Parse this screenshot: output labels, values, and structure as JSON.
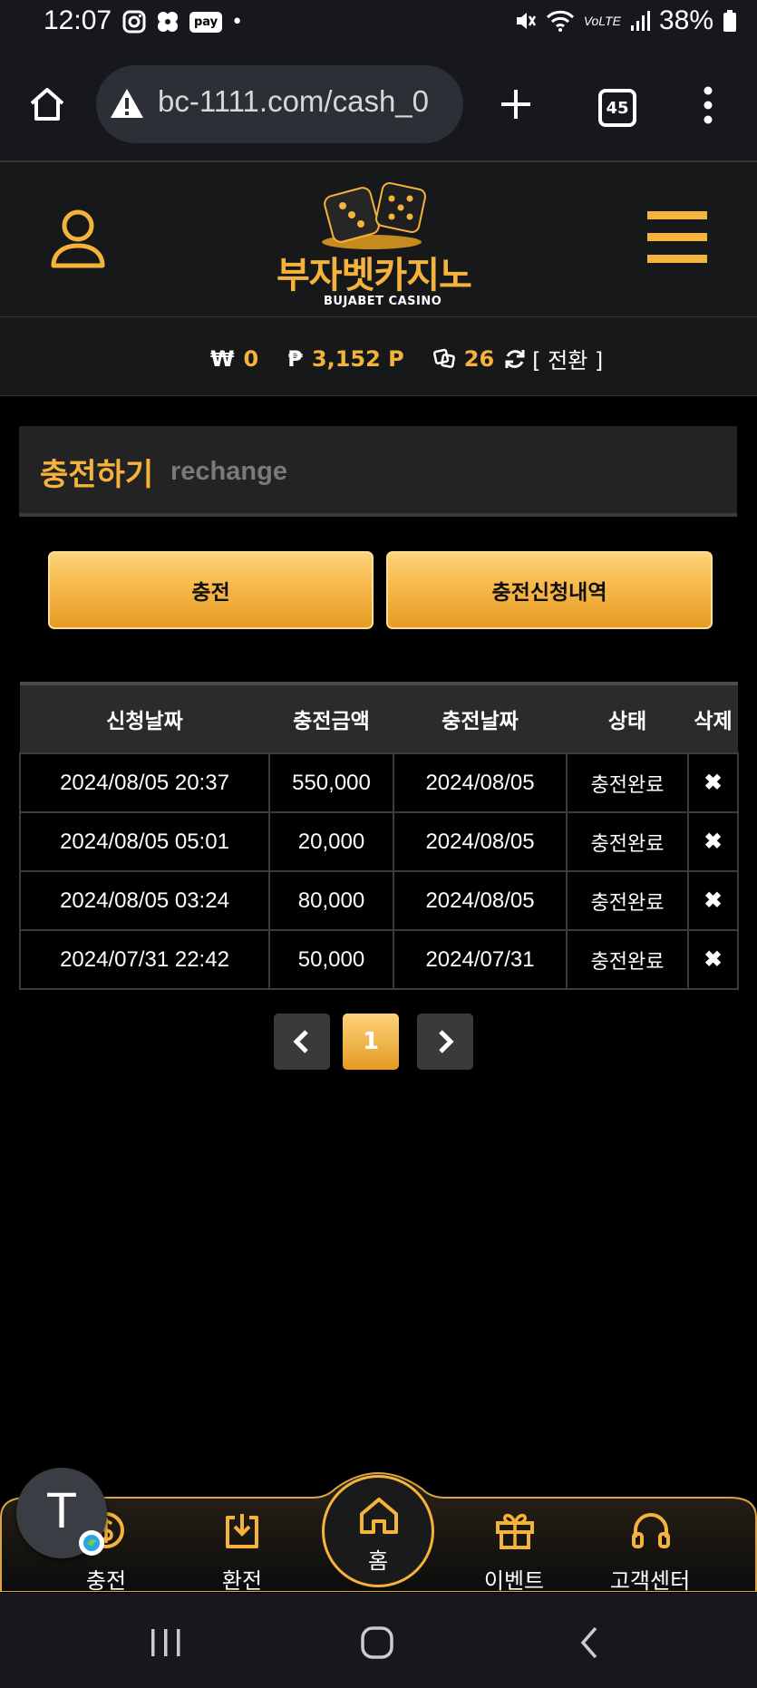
{
  "status_bar": {
    "time": "12:07",
    "pay_badge": "pay",
    "dot": "•",
    "network": "VoLTE",
    "battery": "38%"
  },
  "browser": {
    "url": "bc-1111.com/cash_0",
    "tab_count": "45"
  },
  "header": {
    "logo_text": "부자벳카지노",
    "logo_subtext": "BUJABET CASINO"
  },
  "balance": {
    "won_symbol": "₩",
    "won_value": "0",
    "point_symbol": "₱",
    "point_value": "3,152 P",
    "chip_value": "26",
    "convert_label": "[ 전환 ]"
  },
  "page": {
    "title": "충전하기",
    "subtitle": "rechange"
  },
  "actions": {
    "charge_label": "충전",
    "history_label": "충전신청내역"
  },
  "table": {
    "headers": [
      "신청날짜",
      "충전금액",
      "충전날짜",
      "상태",
      "삭제"
    ],
    "rows": [
      {
        "request_date": "2024/08/05 20:37",
        "amount": "550,000",
        "charge_date": "2024/08/05",
        "status": "충전완료",
        "delete": "✖"
      },
      {
        "request_date": "2024/08/05 05:01",
        "amount": "20,000",
        "charge_date": "2024/08/05",
        "status": "충전완료",
        "delete": "✖"
      },
      {
        "request_date": "2024/08/05 03:24",
        "amount": "80,000",
        "charge_date": "2024/08/05",
        "status": "충전완료",
        "delete": "✖"
      },
      {
        "request_date": "2024/07/31 22:42",
        "amount": "50,000",
        "charge_date": "2024/07/31",
        "status": "충전완료",
        "delete": "✖"
      }
    ]
  },
  "pagination": {
    "current_page": "1"
  },
  "bottom_nav": {
    "items": [
      {
        "label": "충전",
        "icon": "dollar-icon"
      },
      {
        "label": "환전",
        "icon": "download-icon"
      },
      {
        "label": "홈",
        "icon": "home-icon"
      },
      {
        "label": "이벤트",
        "icon": "gift-icon"
      },
      {
        "label": "고객센터",
        "icon": "headset-icon"
      }
    ]
  },
  "floating_button": {
    "letter": "T"
  },
  "colors": {
    "accent": "#f6b33c",
    "background": "#000000",
    "panel": "#17181a"
  }
}
